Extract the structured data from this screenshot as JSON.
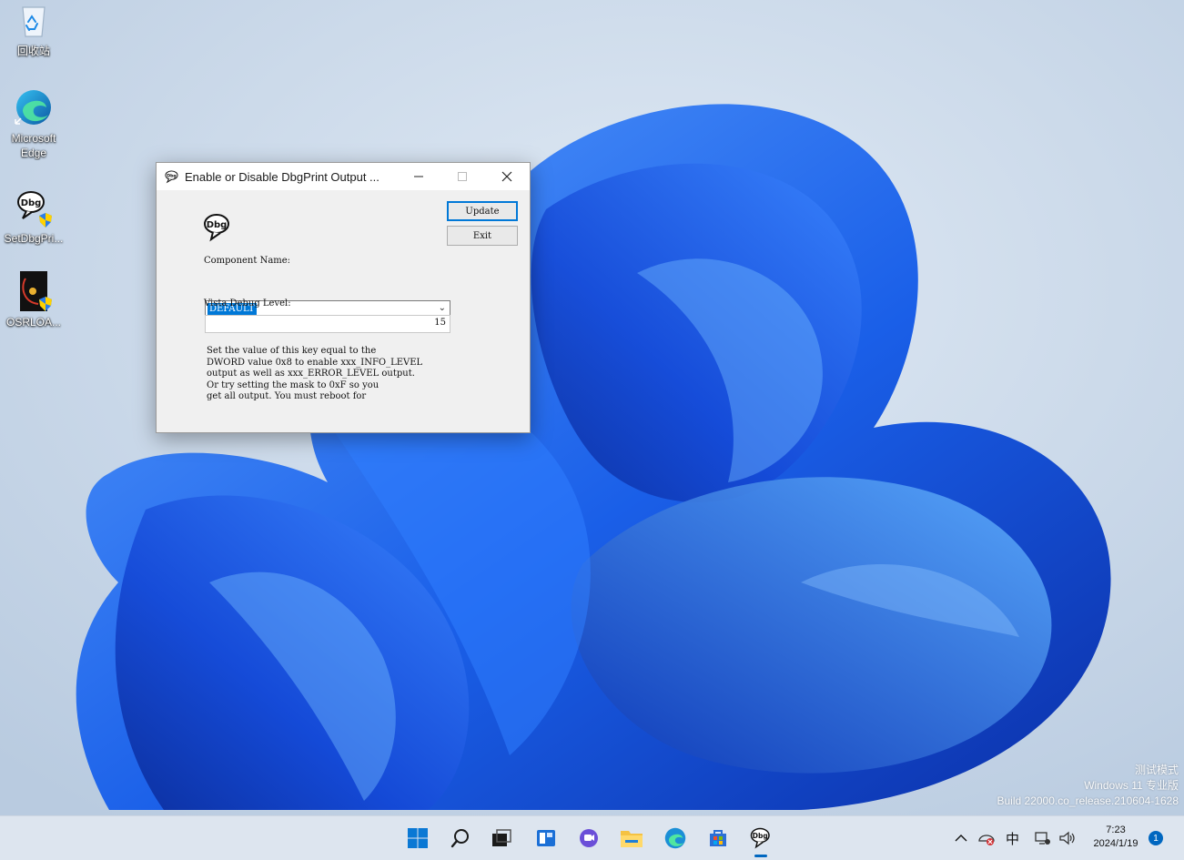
{
  "desktop": {
    "icons": [
      {
        "label": "回收站",
        "icon": "recycle-bin-icon"
      },
      {
        "label": "Microsoft Edge",
        "icon": "edge-icon"
      },
      {
        "label": "SetDbgPri...",
        "icon": "dbg-app-icon"
      },
      {
        "label": "OSRLOA...",
        "icon": "osrloader-icon"
      }
    ],
    "watermark": {
      "line1": "测试模式",
      "line2": "Windows 11 专业版",
      "line3": "Build 22000.co_release.210604-1628"
    }
  },
  "dialog": {
    "title": "Enable or Disable DbgPrint Output ...",
    "app_icon_text": "Dbg",
    "buttons": {
      "update": "Update",
      "exit": "Exit"
    },
    "component_label": "Component Name:",
    "component_value": "DEFAULT",
    "level_label": "Vista Debug Level:",
    "level_value": "15",
    "description": "Set the value of this key equal to the\nDWORD value 0x8 to enable xxx_INFO_LEVEL\noutput as well as xxx_ERROR_LEVEL output.\n Or try setting the mask to 0xF so you\nget all output.  You must reboot for"
  },
  "taskbar": {
    "items": [
      "start-icon",
      "search-icon",
      "task-view-icon",
      "widgets-icon",
      "chat-icon",
      "file-explorer-icon",
      "edge-icon",
      "store-icon",
      "dbg-app-icon"
    ],
    "tray": {
      "ime": "中",
      "time": "7:23",
      "date": "2024/1/19",
      "notifications": "1"
    }
  },
  "colors": {
    "accent": "#0078d7",
    "wallpaper_blue": "#1f5fe0",
    "taskbar": "#dde5ef"
  }
}
